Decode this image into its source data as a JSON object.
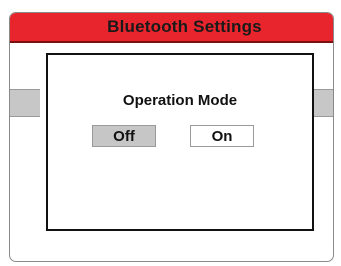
{
  "window": {
    "title": "Bluetooth Settings"
  },
  "dialog": {
    "label": "Operation Mode",
    "options": [
      {
        "label": "Off",
        "selected": true
      },
      {
        "label": "On",
        "selected": false
      }
    ]
  },
  "colors": {
    "title_bar": "#e8242c",
    "selected_option": "#c6c6c6",
    "background_strip": "#c7c7c7"
  }
}
